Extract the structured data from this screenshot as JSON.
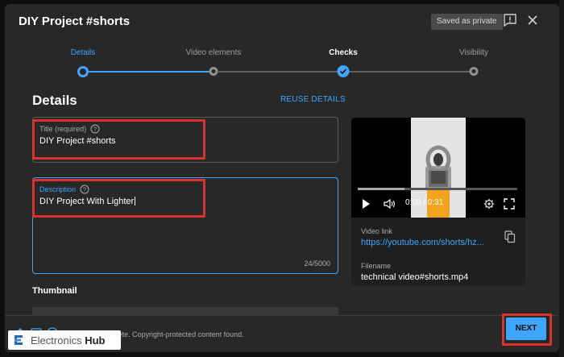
{
  "dialog": {
    "title": "DIY Project #shorts",
    "saved_badge": "Saved as private"
  },
  "stepper": {
    "steps": [
      {
        "label": "Details",
        "state": "current"
      },
      {
        "label": "Video elements",
        "state": "pending"
      },
      {
        "label": "Checks",
        "state": "complete"
      },
      {
        "label": "Visibility",
        "state": "pending"
      }
    ]
  },
  "details": {
    "heading": "Details",
    "reuse_label": "REUSE DETAILS",
    "title_field": {
      "label": "Title (required)",
      "value": "DIY Project #shorts"
    },
    "description_field": {
      "label": "Description",
      "value": "DIY Project With Lighter",
      "count": "24/5000"
    },
    "thumbnail_heading": "Thumbnail"
  },
  "preview": {
    "time": "0:00 / 0:31",
    "video_link_label": "Video link",
    "video_link": "https://youtube.com/shorts/hz...",
    "filename_label": "Filename",
    "filename": "technical video#shorts.mp4"
  },
  "footer": {
    "status": "Checks complete. Copyright-protected content found.",
    "next_label": "NEXT"
  },
  "watermark": {
    "brand_a": "Electronics",
    "brand_b": "Hub"
  },
  "colors": {
    "accent": "#3ea6ff",
    "highlight": "#d9342b",
    "dialog_bg": "#282828"
  }
}
